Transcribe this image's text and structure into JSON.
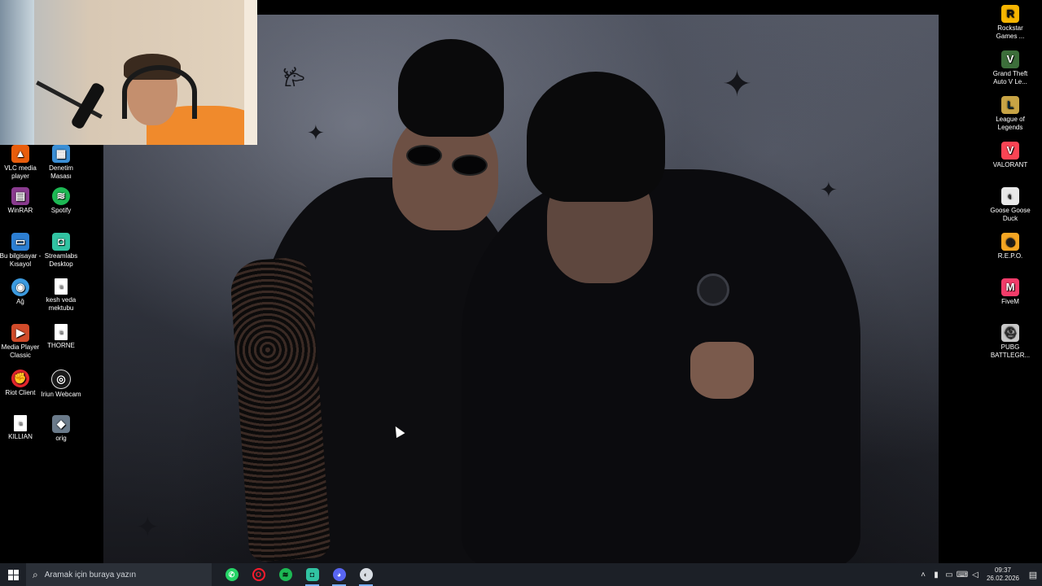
{
  "desktop_icons_left": [
    {
      "label": "VLC media player",
      "icon": "vlc-icon",
      "color": "#e85d0c",
      "glyph": "▲"
    },
    {
      "label": "Denetim Masası",
      "icon": "control-panel-icon",
      "color": "#3a8fd6",
      "glyph": "▦"
    },
    {
      "label": "WinRAR",
      "icon": "winrar-icon",
      "color": "#8a3b8f",
      "glyph": "▤"
    },
    {
      "label": "Spotify",
      "icon": "spotify-icon",
      "color": "#1db954",
      "glyph": "≋"
    },
    {
      "label": "Bu bilgisayar - Kısayol",
      "icon": "this-pc-icon",
      "color": "#2d7fd3",
      "glyph": "▭"
    },
    {
      "label": "Streamlabs Desktop",
      "icon": "streamlabs-icon",
      "color": "#31c3a2",
      "glyph": "◘"
    },
    {
      "label": "Ağ",
      "icon": "network-icon",
      "color": "#3c9be0",
      "glyph": "◉"
    },
    {
      "label": "kesh veda mektubu",
      "icon": "text-file-icon",
      "color": "#ffffff",
      "glyph": "≡"
    },
    {
      "label": "Media Player Classic",
      "icon": "media-player-classic-icon",
      "color": "#d14b2a",
      "glyph": "▶"
    },
    {
      "label": "THORNE",
      "icon": "text-file-icon",
      "color": "#ffffff",
      "glyph": "≡"
    },
    {
      "label": "Riot Client",
      "icon": "riot-client-icon",
      "color": "#e5262d",
      "glyph": "✊"
    },
    {
      "label": "Iriun Webcam",
      "icon": "iriun-webcam-icon",
      "color": "#1a1a1a",
      "glyph": "◎"
    },
    {
      "label": "KILLIAN",
      "icon": "text-file-icon",
      "color": "#ffffff",
      "glyph": "≡"
    },
    {
      "label": "orig",
      "icon": "image-file-icon",
      "color": "#6a7a8a",
      "glyph": "◆"
    }
  ],
  "desktop_icons_right": [
    {
      "label": "Rockstar Games ...",
      "icon": "rockstar-icon",
      "color": "#f7b500",
      "glyph": "R"
    },
    {
      "label": "Grand Theft Auto V Le...",
      "icon": "gta-v-icon",
      "color": "#3c6e3a",
      "glyph": "V"
    },
    {
      "label": "League of Legends",
      "icon": "league-of-legends-icon",
      "color": "#c8a445",
      "glyph": "L"
    },
    {
      "label": "VALORANT",
      "icon": "valorant-icon",
      "color": "#fa4454",
      "glyph": "V"
    },
    {
      "label": "Goose Goose Duck",
      "icon": "goose-goose-duck-icon",
      "color": "#e8e8e8",
      "glyph": "◐"
    },
    {
      "label": "R.E.P.O.",
      "icon": "repo-icon",
      "color": "#f5a623",
      "glyph": "◍"
    },
    {
      "label": "FiveM",
      "icon": "fivem-icon",
      "color": "#f23c6a",
      "glyph": "M"
    },
    {
      "label": "PUBG BATTLEGR...",
      "icon": "pubg-icon",
      "color": "#c9c9c9",
      "glyph": "⛑"
    }
  ],
  "taskbar": {
    "search_placeholder": "Aramak için buraya yazın",
    "apps": [
      {
        "name": "whatsapp",
        "icon": "whatsapp-icon",
        "color": "#25d366",
        "glyph": "✆",
        "active": false
      },
      {
        "name": "opera-gx",
        "icon": "opera-icon",
        "color": "#ff1b2d",
        "glyph": "O",
        "active": false
      },
      {
        "name": "spotify",
        "icon": "spotify-icon",
        "color": "#1db954",
        "glyph": "≋",
        "active": false
      },
      {
        "name": "streamlabs",
        "icon": "streamlabs-icon",
        "color": "#31c3a2",
        "glyph": "◘",
        "active": true
      },
      {
        "name": "discord",
        "icon": "discord-icon",
        "color": "#5865f2",
        "glyph": "◕",
        "active": true
      },
      {
        "name": "goose-goose-duck",
        "icon": "goose-goose-duck-icon",
        "color": "#d8dde3",
        "glyph": "◐",
        "active": true
      }
    ],
    "clock_time": "09:37",
    "clock_date": "26.02.2026"
  }
}
